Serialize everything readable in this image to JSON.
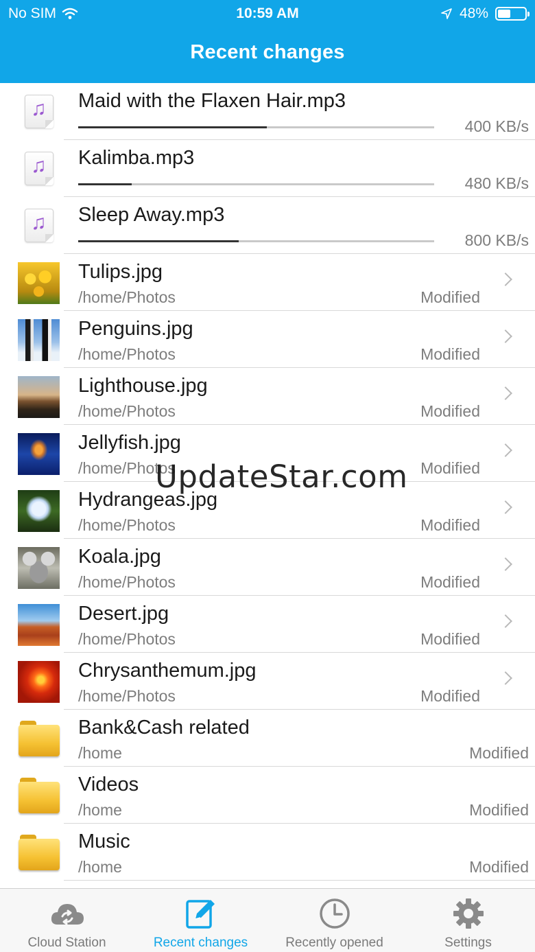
{
  "status_bar": {
    "carrier": "No SIM",
    "time": "10:59 AM",
    "battery": "48%",
    "battery_level": 0.48
  },
  "header": {
    "title": "Recent changes"
  },
  "transfers": [
    {
      "name": "Maid with the Flaxen Hair.mp3",
      "speed": "400 KB/s",
      "progress": 0.53,
      "icon": "music-file-icon"
    },
    {
      "name": "Kalimba.mp3",
      "speed": "480 KB/s",
      "progress": 0.15,
      "icon": "music-file-icon"
    },
    {
      "name": "Sleep Away.mp3",
      "speed": "800 KB/s",
      "progress": 0.45,
      "icon": "music-file-icon"
    }
  ],
  "photos": [
    {
      "name": "Tulips.jpg",
      "path": "/home/Photos",
      "status": "Modified",
      "thumb": "tulips"
    },
    {
      "name": "Penguins.jpg",
      "path": "/home/Photos",
      "status": "Modified",
      "thumb": "penguins"
    },
    {
      "name": "Lighthouse.jpg",
      "path": "/home/Photos",
      "status": "Modified",
      "thumb": "lighthouse"
    },
    {
      "name": "Jellyfish.jpg",
      "path": "/home/Photos",
      "status": "Modified",
      "thumb": "jellyfish"
    },
    {
      "name": "Hydrangeas.jpg",
      "path": "/home/Photos",
      "status": "Modified",
      "thumb": "hydrangeas"
    },
    {
      "name": "Koala.jpg",
      "path": "/home/Photos",
      "status": "Modified",
      "thumb": "koala"
    },
    {
      "name": "Desert.jpg",
      "path": "/home/Photos",
      "status": "Modified",
      "thumb": "desert"
    },
    {
      "name": "Chrysanthemum.jpg",
      "path": "/home/Photos",
      "status": "Modified",
      "thumb": "chrysanthemum"
    }
  ],
  "folders": [
    {
      "name": "Bank&Cash related",
      "path": "/home",
      "status": "Modified",
      "icon": "folder-icon"
    },
    {
      "name": "Videos",
      "path": "/home",
      "status": "Modified",
      "icon": "folder-icon"
    },
    {
      "name": "Music",
      "path": "/home",
      "status": "Modified",
      "icon": "folder-icon"
    }
  ],
  "tabbar": {
    "tabs": [
      {
        "label": "Cloud Station",
        "icon": "cloud-sync-icon",
        "active": false
      },
      {
        "label": "Recent changes",
        "icon": "edit-note-icon",
        "active": true
      },
      {
        "label": "Recently opened",
        "icon": "clock-icon",
        "active": false
      },
      {
        "label": "Settings",
        "icon": "gear-icon",
        "active": false
      }
    ]
  },
  "watermark": "UpdateStar.com",
  "colors": {
    "accent": "#11a6e8",
    "music_note": "#9b59d0",
    "folder": "#f5c132"
  }
}
